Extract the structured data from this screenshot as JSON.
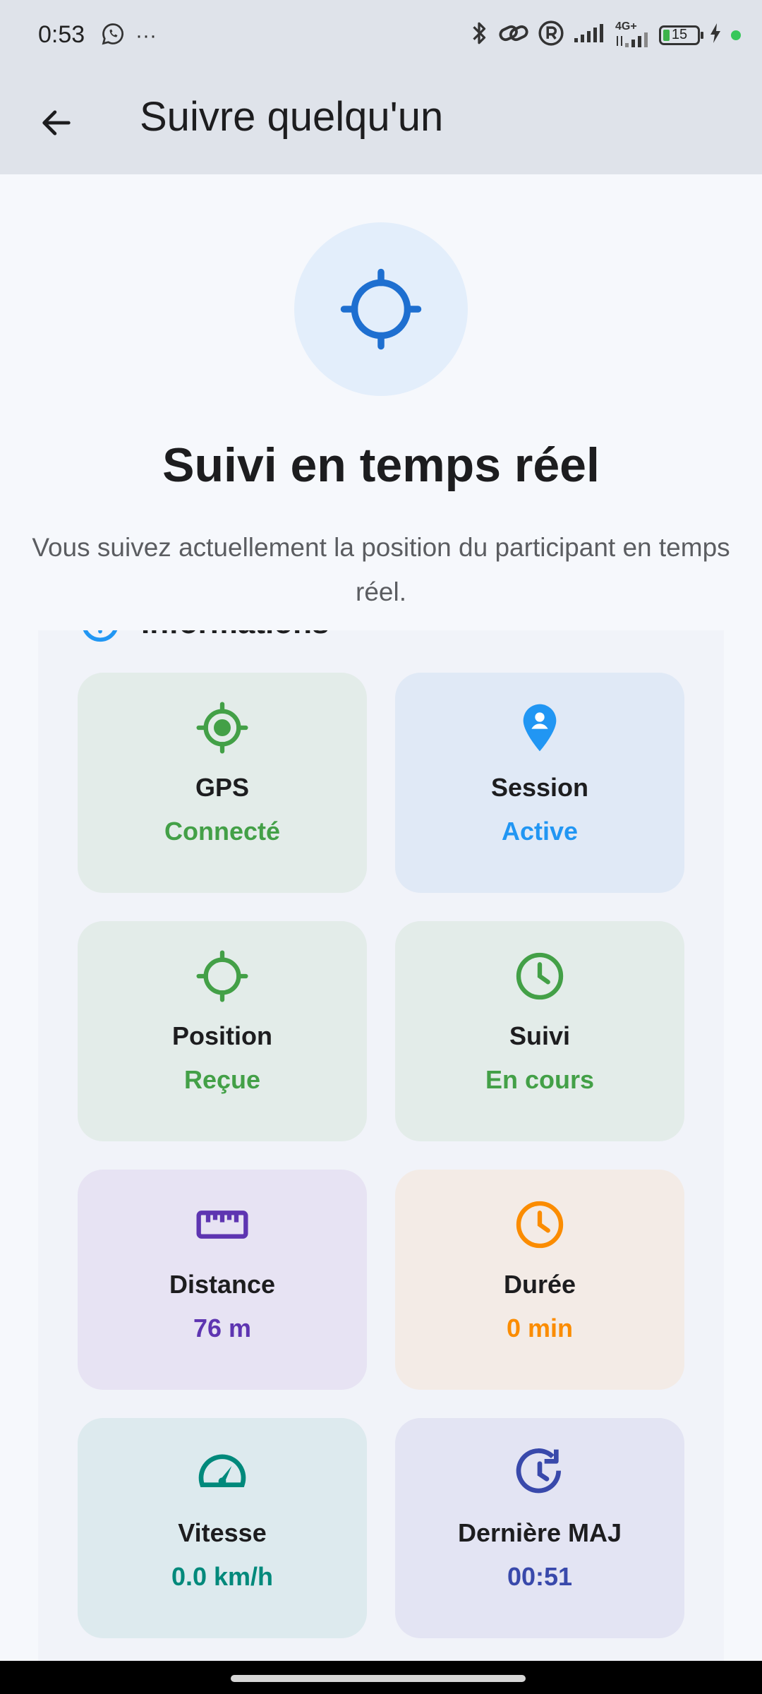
{
  "status_bar": {
    "time": "0:53",
    "more": "···",
    "network_label": "4G+",
    "battery_level": "15",
    "colors": {
      "battery_fill": "#3db24a",
      "status_dot": "#37c75a"
    }
  },
  "app_bar": {
    "title": "Suivre quelqu'un",
    "back_icon": "arrow-left-icon"
  },
  "hero": {
    "icon": "crosshair-icon",
    "title": "Suivi en temps réel",
    "subtitle": "Vous suivez actuellement la position du participant en temps réel."
  },
  "info_card": {
    "title": "Informations",
    "tiles": [
      {
        "icon": "gps-fixed-icon",
        "label": "GPS",
        "value": "Connecté",
        "color": "#43a047"
      },
      {
        "icon": "person-pin-icon",
        "label": "Session",
        "value": "Active",
        "color": "#2196f3"
      },
      {
        "icon": "crosshair-icon",
        "label": "Position",
        "value": "Reçue",
        "color": "#43a047"
      },
      {
        "icon": "clock-icon",
        "label": "Suivi",
        "value": "En cours",
        "color": "#43a047"
      },
      {
        "icon": "ruler-icon",
        "label": "Distance",
        "value": "76 m",
        "color": "#5e35b1"
      },
      {
        "icon": "clock-icon",
        "label": "Durée",
        "value": "0 min",
        "color": "#fb8c00"
      },
      {
        "icon": "speedometer-icon",
        "label": "Vitesse",
        "value": "0.0 km/h",
        "color": "#00897b"
      },
      {
        "icon": "update-icon",
        "label": "Dernière MAJ",
        "value": "00:51",
        "color": "#3949ab"
      }
    ]
  }
}
